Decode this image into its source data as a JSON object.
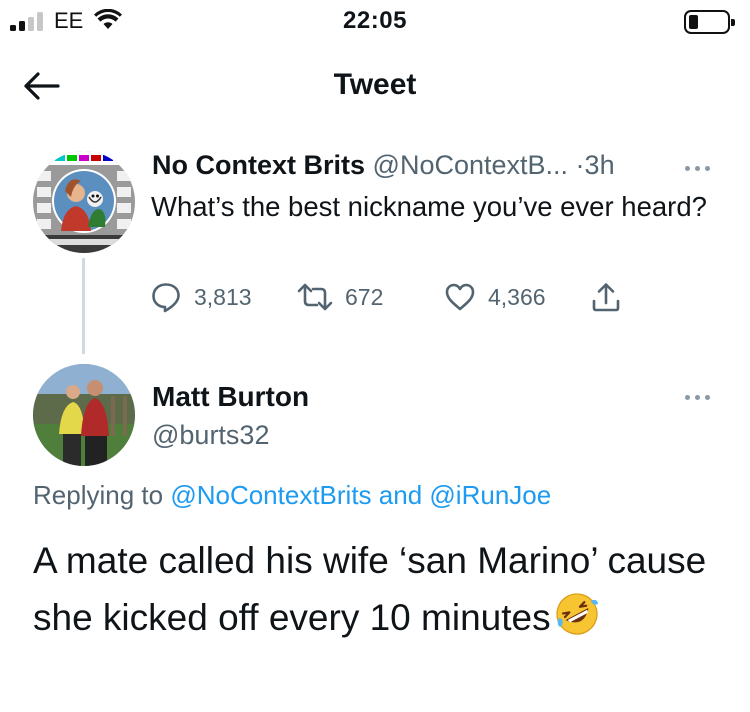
{
  "status_bar": {
    "carrier": "EE",
    "time": "22:05",
    "signal_bars_filled": 2,
    "signal_bars_total": 4,
    "battery_level": 0.2
  },
  "header": {
    "title": "Tweet",
    "back_icon": "arrow-left-icon"
  },
  "original_tweet": {
    "name": "No Context Brits",
    "handle": "@NoContextB...",
    "separator": "·",
    "time": "3h",
    "text": "What’s the best nickname you’ve ever heard?",
    "replies": "3,813",
    "retweets": "672",
    "likes": "4,366",
    "icons": [
      "reply-icon",
      "retweet-icon",
      "like-icon",
      "share-icon",
      "more-icon"
    ]
  },
  "reply_tweet": {
    "name": "Matt Burton",
    "handle": "@burts32",
    "replying_prefix": "Replying to",
    "replying_user_1": "@NoContextBrits",
    "replying_and": "and",
    "replying_user_2": "@iRunJoe",
    "text": "A mate called his wife ‘san Marino’ cause she kicked off every 10 minutes",
    "emoji": "rolling-on-floor-laughing-emoji"
  },
  "colors": {
    "accent": "#1d9bf0",
    "text_primary": "#0f1419",
    "text_secondary": "#536471",
    "thread_line": "#cfd9de"
  }
}
